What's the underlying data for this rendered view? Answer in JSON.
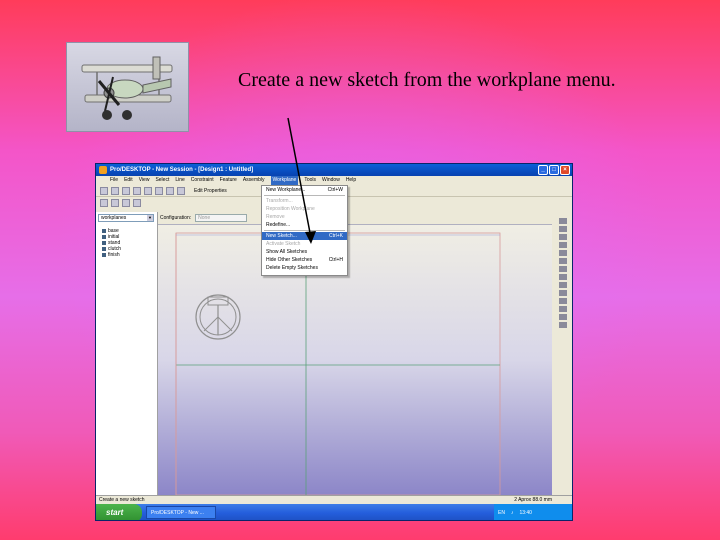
{
  "slide": {
    "caption": "Create a new sketch from the workplane menu."
  },
  "window": {
    "title": "Pro/DESKTOP - New Session - [Design1 : Untitled]",
    "menus": [
      "File",
      "Edit",
      "View",
      "Select",
      "Line",
      "Constraint",
      "Feature",
      "Assembly",
      "Workplane",
      "Tools",
      "Window",
      "Help"
    ],
    "active_menu": "Workplane",
    "edit_properties": "Edit Properties"
  },
  "dropdown": {
    "items": [
      {
        "label": "New Workplane...",
        "shortcut": "Ctrl+W",
        "state": "normal"
      },
      {
        "label": "Transform...",
        "shortcut": "",
        "state": "disabled"
      },
      {
        "label": "Reposition Workplane",
        "shortcut": "",
        "state": "disabled"
      },
      {
        "label": "Remove",
        "shortcut": "",
        "state": "disabled"
      },
      {
        "label": "Redefine...",
        "shortcut": "",
        "state": "normal"
      },
      {
        "label": "New Sketch...",
        "shortcut": "Ctrl+K",
        "state": "highlight"
      },
      {
        "label": "Activate Sketch",
        "shortcut": "",
        "state": "disabled"
      },
      {
        "label": "Show All Sketches",
        "shortcut": "",
        "state": "normal"
      },
      {
        "label": "Hide Other Sketches",
        "shortcut": "Ctrl+H",
        "state": "normal"
      },
      {
        "label": "Delete Empty Sketches",
        "shortcut": "",
        "state": "normal"
      }
    ]
  },
  "left_panel": {
    "browser_select": "workplanes",
    "tree": [
      "base",
      "initial",
      "stand",
      "clutch",
      "finish"
    ]
  },
  "config": {
    "label": "Configuration:",
    "value": "None"
  },
  "status": {
    "left": "Create a new sketch",
    "units": "2 Aprox 88.0 mm"
  },
  "taskbar": {
    "start": "start",
    "task": "Pro/DESKTOP - New ...",
    "tray_lang": "EN",
    "clock": "13:40"
  },
  "colors": {
    "highlight": "#316ac5",
    "titlebar": "#0a5fd8",
    "slide_bg": "#e66ee8"
  }
}
